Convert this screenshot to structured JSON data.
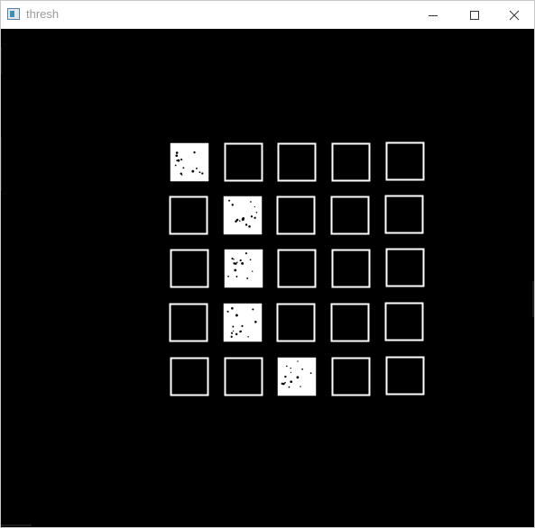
{
  "window": {
    "title": "thresh",
    "controls": [
      "minimize-icon",
      "maximize-icon",
      "close-icon"
    ]
  },
  "image": {
    "background_color": "#000000",
    "foreground_color": "#ffffff",
    "grid": {
      "rows": 5,
      "columns": 5,
      "filled_cells": [
        {
          "row": 1,
          "col": 1
        },
        {
          "row": 2,
          "col": 2
        },
        {
          "row": 3,
          "col": 2
        },
        {
          "row": 4,
          "col": 2
        },
        {
          "row": 5,
          "col": 3
        }
      ]
    }
  }
}
